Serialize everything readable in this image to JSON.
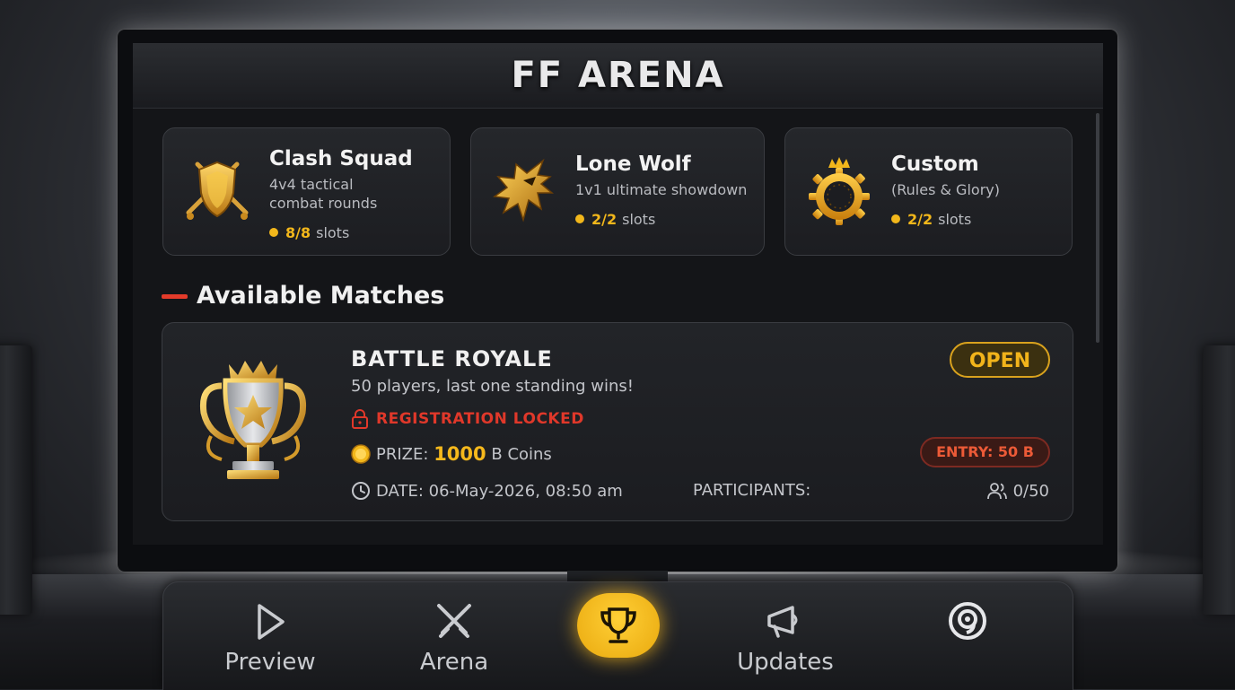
{
  "app": {
    "title": "FF ARENA"
  },
  "modes": [
    {
      "title": "Clash Squad",
      "desc_line1": "4v4 tactical",
      "desc_line2": "combat rounds",
      "slots_count": "8/8",
      "slots_label": "slots",
      "icon": "shield-swords-icon"
    },
    {
      "title": "Lone Wolf",
      "desc_line1": "1v1 ultimate showdown",
      "slots_count": "2/2",
      "slots_label": "slots",
      "icon": "wolf-icon"
    },
    {
      "title": "Custom",
      "desc_line1": "(Rules & Glory)",
      "slots_count": "2/2",
      "slots_label": "slots",
      "icon": "crown-gear-icon"
    }
  ],
  "section": {
    "title": "Available Matches"
  },
  "match": {
    "title": "BATTLE ROYALE",
    "subtitle": "50 players, last one standing wins!",
    "status_text": "REGISTRATION LOCKED",
    "prize_label": "PRIZE:",
    "prize_amount": "1000",
    "prize_unit": "B Coins",
    "date_text": "DATE: 06-May-2026, 08:50 am",
    "participants_label": "PARTICIPANTS:",
    "participants_count": "0/50",
    "badge_open": "OPEN",
    "badge_entry": "ENTRY: 50 B"
  },
  "nav": {
    "items": [
      {
        "label": "Preview",
        "icon": "play-icon"
      },
      {
        "label": "Arena",
        "icon": "crossed-swords-icon"
      },
      {
        "label": "",
        "icon": "trophy-icon"
      },
      {
        "label": "Updates",
        "icon": "megaphone-icon"
      },
      {
        "label": "",
        "icon": "spiral-icon"
      }
    ]
  },
  "colors": {
    "accent": "#f2b71b",
    "danger": "#e0382a",
    "panel": "#1c1d21"
  }
}
